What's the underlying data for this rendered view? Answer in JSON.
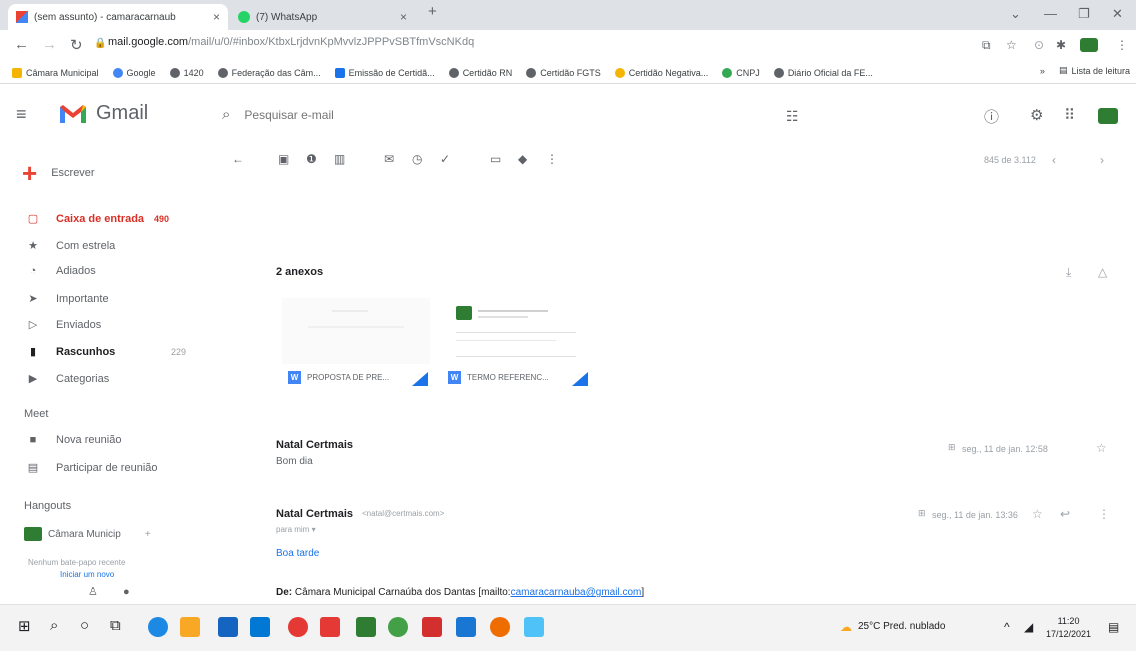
{
  "browser": {
    "tabs": [
      {
        "title": "(sem assunto) - camaracarnaub",
        "close": "×"
      },
      {
        "title": "(7) WhatsApp",
        "close": "×"
      }
    ],
    "new_tab": "+",
    "window_controls": {
      "chevron": "⌄",
      "minimize": "—",
      "restore": "❐",
      "close": "✕"
    },
    "url_host": "mail.google.com",
    "url_path": "/mail/u/0/#inbox/KtbxLrjdvnKpMvvlzJPPPvSBTfmVscNKdq",
    "bookmarks": [
      {
        "label": "Câmara Municipal",
        "color": "#f4b400"
      },
      {
        "label": "Google",
        "color": "#4285f4"
      },
      {
        "label": "1420",
        "color": "#5f6368"
      },
      {
        "label": "Federação das Câm...",
        "color": "#5f6368"
      },
      {
        "label": "Emissão de Certidã...",
        "color": "#1a73e8"
      },
      {
        "label": "Certidão RN",
        "color": "#5f6368"
      },
      {
        "label": "Certidão FGTS",
        "color": "#5f6368"
      },
      {
        "label": "Certidão Negativa...",
        "color": "#f4b400"
      },
      {
        "label": "CNPJ",
        "color": "#34a853"
      },
      {
        "label": "Diário Oficial da FE...",
        "color": "#5f6368"
      }
    ],
    "bookmarks_more": "»",
    "reading_list": "Lista de leitura"
  },
  "gmail": {
    "logo_text": "Gmail",
    "search_placeholder": "Pesquisar e-mail",
    "compose_label": "Escrever",
    "nav": [
      {
        "label": "Caixa de entrada",
        "count": "490"
      },
      {
        "label": "Com estrela",
        "count": ""
      },
      {
        "label": "Adiados",
        "count": ""
      },
      {
        "label": "Importante",
        "count": ""
      },
      {
        "label": "Enviados",
        "count": ""
      },
      {
        "label": "Rascunhos",
        "count": "229"
      },
      {
        "label": "Categorias",
        "count": ""
      }
    ],
    "meet_title": "Meet",
    "meet_items": [
      "Nova reunião",
      "Participar de reunião"
    ],
    "hangouts_title": "Hangouts",
    "hangouts_user": "Câmara Municip",
    "hangouts_plus": "+",
    "no_chat": "Nenhum bate-papo recente",
    "start_new": "Iniciar um novo",
    "pager": "845 de 3.112",
    "attachments_title": "2 anexos",
    "attachments": [
      {
        "name": "PROPOSTA DE PRE...",
        "type": "W"
      },
      {
        "name": "TERMO REFERENC...",
        "type": "W"
      }
    ],
    "messages": [
      {
        "sender": "Natal Certmais",
        "snippet": "Bom dia",
        "date": "seg., 11 de jan. 12:58"
      },
      {
        "sender": "Natal Certmais",
        "email": "<natal@certmais.com>",
        "to": "para mim ▾",
        "date": "seg., 11 de jan. 13:36"
      }
    ],
    "body_greeting": "Boa tarde",
    "from_label": "De:",
    "from_name": "Câmara Municipal Carnaúba dos Dantas [mailto:",
    "from_email": "camaracarnauba@gmail.com",
    "from_end": "]"
  },
  "taskbar": {
    "weather": "25°C  Pred. nublado",
    "time": "11:20",
    "date": "17/12/2021"
  }
}
